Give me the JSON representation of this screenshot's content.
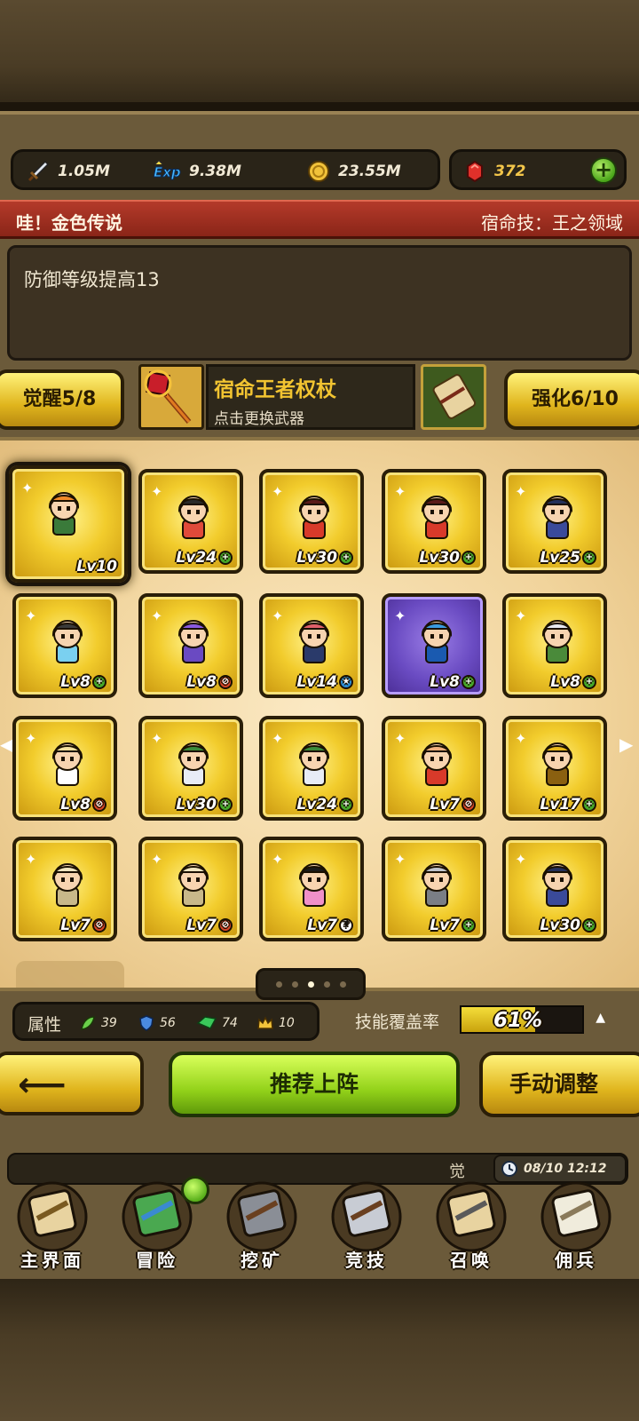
{
  "resources": {
    "attack": "1.05M",
    "exp": "9.38M",
    "gold": "23.55M",
    "gems": "372",
    "add": "+"
  },
  "banner": {
    "title": "哇！金色传说",
    "destiny_skill": "宿命技：王之领域"
  },
  "description": "防御等级提高13",
  "awaken": {
    "label": "觉醒5/8"
  },
  "weapon": {
    "name": "宿命王者权杖",
    "hint": "点击更换武器"
  },
  "upgrade": {
    "label": "强化6/10"
  },
  "heroes": [
    {
      "lv": "Lv10",
      "badge": "",
      "sprite": "orange-hair-hero",
      "frame": "gold",
      "selected": true
    },
    {
      "lv": "Lv24",
      "badge": "up",
      "sprite": "black-hair-girl",
      "frame": "gold"
    },
    {
      "lv": "Lv30",
      "badge": "up",
      "sprite": "red-headband-girl",
      "frame": "gold"
    },
    {
      "lv": "Lv30",
      "badge": "up",
      "sprite": "red-headband-girl",
      "frame": "gold"
    },
    {
      "lv": "Lv25",
      "badge": "up",
      "sprite": "dark-mage",
      "frame": "gold"
    },
    {
      "lv": "Lv8",
      "badge": "up",
      "sprite": "headband-girl",
      "frame": "gold"
    },
    {
      "lv": "Lv8",
      "badge": "no",
      "sprite": "purple-hair-girl",
      "frame": "gold"
    },
    {
      "lv": "Lv14",
      "badge": "star",
      "sprite": "pink-ponytail-girl",
      "frame": "gold"
    },
    {
      "lv": "Lv8",
      "badge": "up",
      "sprite": "blue-dragon",
      "frame": "purple"
    },
    {
      "lv": "Lv8",
      "badge": "up",
      "sprite": "white-hair-elder",
      "frame": "gold"
    },
    {
      "lv": "Lv8",
      "badge": "no",
      "sprite": "blonde-angel",
      "frame": "gold"
    },
    {
      "lv": "Lv30",
      "badge": "up",
      "sprite": "green-hair-girl",
      "frame": "gold"
    },
    {
      "lv": "Lv24",
      "badge": "up",
      "sprite": "green-hair-girl",
      "frame": "gold"
    },
    {
      "lv": "Lv7",
      "badge": "no",
      "sprite": "bald-brawler",
      "frame": "gold"
    },
    {
      "lv": "Lv17",
      "badge": "up",
      "sprite": "golden-beast",
      "frame": "gold"
    },
    {
      "lv": "Lv7",
      "badge": "no",
      "sprite": "bone-creature",
      "frame": "gold"
    },
    {
      "lv": "Lv7",
      "badge": "no",
      "sprite": "bone-creature",
      "frame": "gold"
    },
    {
      "lv": "Lv7",
      "badge": "q",
      "sprite": "black-hair-bride",
      "frame": "gold"
    },
    {
      "lv": "Lv7",
      "badge": "up",
      "sprite": "stone-gargoyle",
      "frame": "gold"
    },
    {
      "lv": "Lv30",
      "badge": "up",
      "sprite": "dark-mage",
      "frame": "gold"
    }
  ],
  "pager": {
    "total": 5,
    "active": 2
  },
  "stats": {
    "label": "属性",
    "agility": "39",
    "defense": "56",
    "attack": "74",
    "crown": "10"
  },
  "skill_coverage": {
    "label": "技能覆盖率",
    "value": "61%",
    "fraction": 0.61
  },
  "buttons": {
    "back": "back-arrow",
    "recommend": "推荐上阵",
    "manual": "手动调整"
  },
  "notice": {
    "text": "觉",
    "time": "08/10 12:12"
  },
  "nav": [
    {
      "label": "主界面",
      "icon": "map-scroll-icon"
    },
    {
      "label": "冒险",
      "icon": "island-icon"
    },
    {
      "label": "挖矿",
      "icon": "pickaxe-icon"
    },
    {
      "label": "竞技",
      "icon": "crossed-swords-icon"
    },
    {
      "label": "召唤",
      "icon": "summon-scroll-icon"
    },
    {
      "label": "佣兵",
      "icon": "tent-icon"
    }
  ],
  "colors": {
    "gold_card": "#f2cc2c",
    "purple_card": "#6a4bc2",
    "banner_red": "#b43a2a",
    "recommend_green": "#93d21a"
  }
}
